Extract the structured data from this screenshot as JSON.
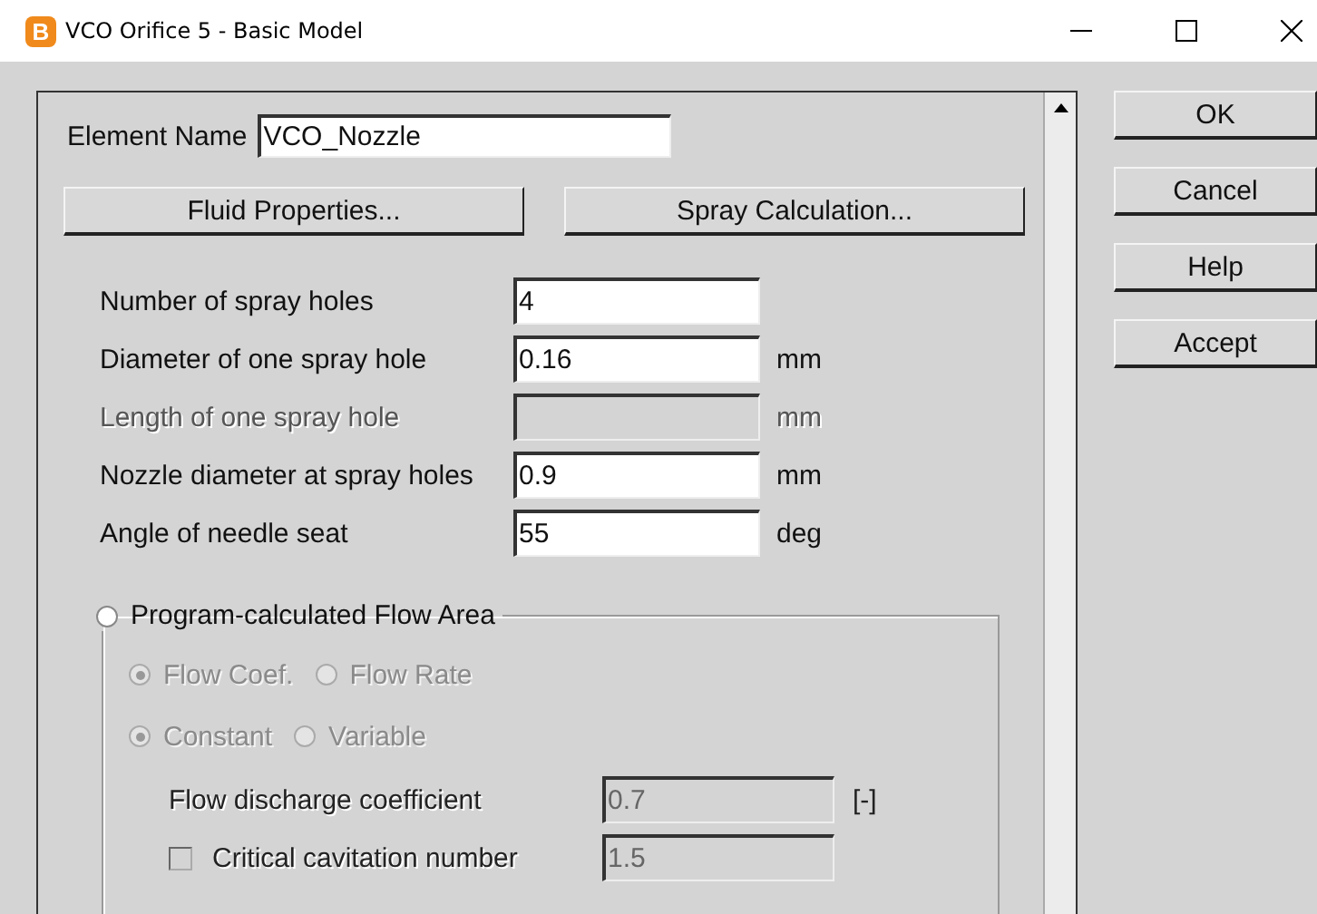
{
  "window": {
    "title": "VCO Orifice 5 - Basic Model",
    "app_icon": "B"
  },
  "element_name": {
    "label": "Element Name",
    "value": "VCO_Nozzle"
  },
  "top_buttons": [
    "Fluid Properties...",
    "Spray Calculation..."
  ],
  "fields": [
    {
      "label": "Number of spray holes",
      "value": "4",
      "disabled": false
    },
    {
      "label": "Diameter of one spray hole",
      "value": "0.16",
      "unit": "mm",
      "disabled": false
    },
    {
      "label": "Length of one spray hole",
      "unit": "mm",
      "disabled": true
    },
    {
      "label": "Nozzle diameter at spray holes",
      "value": "0.9",
      "unit": "mm",
      "disabled": false
    },
    {
      "label": "Angle of needle seat",
      "value": "55",
      "unit": "deg",
      "disabled": false
    }
  ],
  "flow_area": {
    "label": "Program-calculated Flow Area",
    "selected": false,
    "radio_rows": [
      [
        {
          "label": "Flow Coef.",
          "selected": true,
          "disabled": true
        },
        {
          "label": "Flow Rate",
          "selected": false,
          "disabled": true
        }
      ],
      [
        {
          "label": "Constant",
          "selected": true,
          "disabled": true
        },
        {
          "label": "Variable",
          "selected": false,
          "disabled": true
        }
      ]
    ],
    "rows": [
      {
        "kind": "plain",
        "label": "Flow discharge coefficient",
        "value": "0.7",
        "unit": "[-]",
        "disabled": true
      },
      {
        "kind": "checkbox",
        "label": "Critical cavitation number",
        "value": "1.5",
        "checked": false,
        "disabled": true
      }
    ]
  },
  "side_buttons": [
    "OK",
    "Cancel",
    "Help",
    "Accept"
  ]
}
